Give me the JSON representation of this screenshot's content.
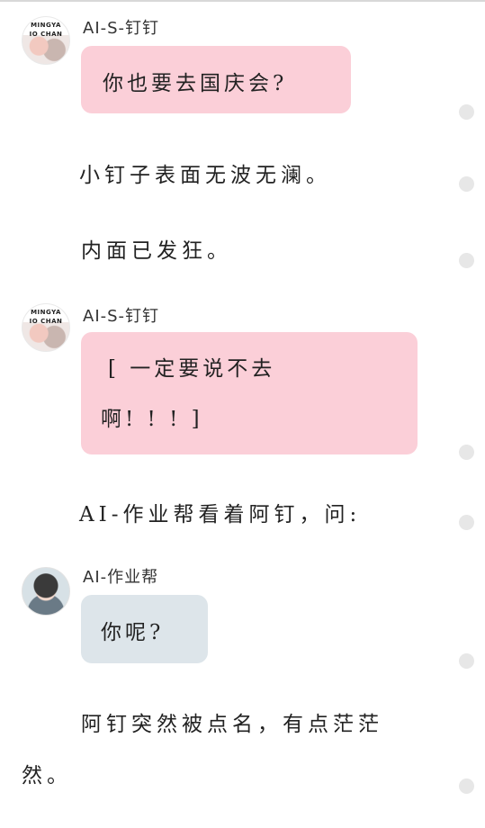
{
  "messages": [
    {
      "speaker": "AI-S-钉钉",
      "text": "你也要去国庆会?"
    },
    {
      "speaker": "AI-S-钉钉",
      "line1": "[ 一定要说不去",
      "line2": "啊! ! ! ]"
    },
    {
      "speaker": "AI-作业帮",
      "text": "你呢?"
    }
  ],
  "narration": [
    "小钉子表面无波无澜。",
    "内面已发狂。",
    "AI-作业帮看着阿钉，问:",
    "阿钉突然被点名，有点茫茫",
    "然。"
  ],
  "avatars": {
    "ding_line1": "MINGYA",
    "ding_line2": "IO CHAN"
  },
  "colors": {
    "pink_bubble": "#fbcfd8",
    "blue_bubble": "#dde5ea",
    "dot": "#e7e7e7"
  }
}
